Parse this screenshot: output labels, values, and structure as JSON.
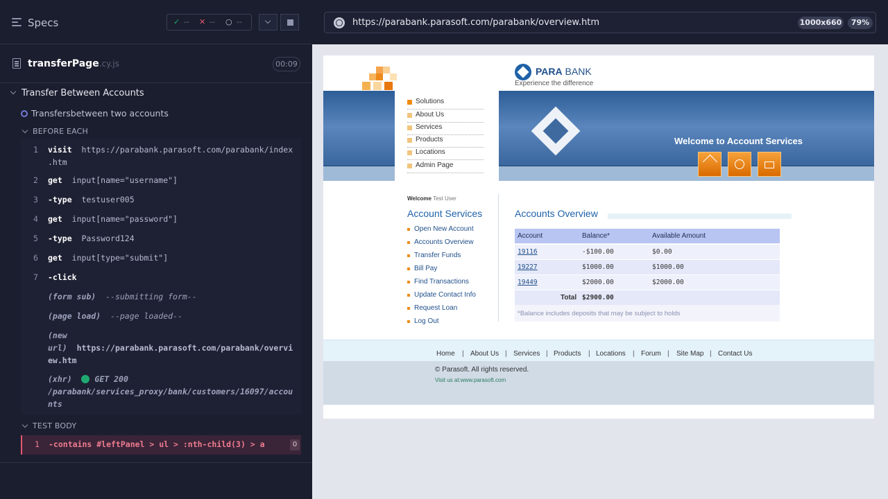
{
  "runner": {
    "specs_label": "Specs",
    "stats": {
      "passed": "--",
      "failed": "--",
      "pending": "--"
    },
    "spec": {
      "name": "transferPage",
      "ext": ".cy.js",
      "duration": "00:09"
    },
    "suite_title": "Transfer Between Accounts",
    "test_title": "Transfersbetween two accounts",
    "before_each_label": "BEFORE EACH",
    "test_body_label": "TEST BODY",
    "commands": [
      {
        "num": "1",
        "cmd": "visit",
        "arg": "https://parabank.parasoft.com/parabank/index",
        "arg2": ".htm"
      },
      {
        "num": "2",
        "cmd": "get",
        "arg": "input[name=\"username\"]"
      },
      {
        "num": "3",
        "cmd": "-type",
        "arg": "testuser005"
      },
      {
        "num": "4",
        "cmd": "get",
        "arg": "input[name=\"password\"]"
      },
      {
        "num": "5",
        "cmd": "-type",
        "arg": "Password124"
      },
      {
        "num": "6",
        "cmd": "get",
        "arg": "input[type=\"submit\"]"
      },
      {
        "num": "7",
        "cmd": "-click",
        "arg": ""
      }
    ],
    "events": {
      "form_sub": {
        "label": "(form sub)",
        "text": "--submitting form--"
      },
      "page_load": {
        "label": "(page load)",
        "text": "--page loaded--"
      },
      "new_url": {
        "label1": "(new",
        "label2": "url)",
        "line1": "https://parabank.parasoft.com/parabank/overvi",
        "line2": "ew.htm"
      },
      "xhr": {
        "label": "(xhr)",
        "status": "GET 200",
        "line1": "/parabank/services_proxy/bank/customers/16097/accou",
        "line2": "nts"
      }
    },
    "failed_command": {
      "num": "1",
      "text": "-contains  #leftPanel > ul > :nth-child(3) > a",
      "badge": "0"
    },
    "colors": {
      "accent": "#7479d6",
      "failed": "#e45770",
      "pass": "#1fa971"
    }
  },
  "preview": {
    "url": "https://parabank.parasoft.com/parabank/overview.htm",
    "viewport": "1000x660",
    "zoom": "79%"
  },
  "parabank": {
    "brand_bold": "PARA",
    "brand_rest": " BANK",
    "tagline": "Experience the difference",
    "menu": [
      "Solutions",
      "About Us",
      "Services",
      "Products",
      "Locations",
      "Admin Page"
    ],
    "banner_welcome": "Welcome to Account Services",
    "welcome_prefix": "Welcome",
    "welcome_user": "Test User",
    "account_services_title": "Account Services",
    "account_links": [
      "Open New Account",
      "Accounts Overview",
      "Transfer Funds",
      "Bill Pay",
      "Find Transactions",
      "Update Contact Info",
      "Request Loan",
      "Log Out"
    ],
    "overview_title": "Accounts Overview",
    "table": {
      "headers": [
        "Account",
        "Balance*",
        "Available Amount"
      ],
      "rows": [
        {
          "account": "19116",
          "balance": "-$100.00",
          "available": "$0.00"
        },
        {
          "account": "19227",
          "balance": "$1000.00",
          "available": "$1000.00"
        },
        {
          "account": "19449",
          "balance": "$2000.00",
          "available": "$2000.00"
        }
      ],
      "total_label": "Total",
      "total_value": "$2900.00",
      "note": "*Balance includes deposits that may be subject to holds"
    },
    "footer_links": [
      "Home",
      "About Us",
      "Services",
      "Products",
      "Locations",
      "Forum",
      "Site Map",
      "Contact Us"
    ],
    "copyright": "© Parasoft. All rights reserved.",
    "visit": "Visit us at:www.parasoft.com"
  }
}
